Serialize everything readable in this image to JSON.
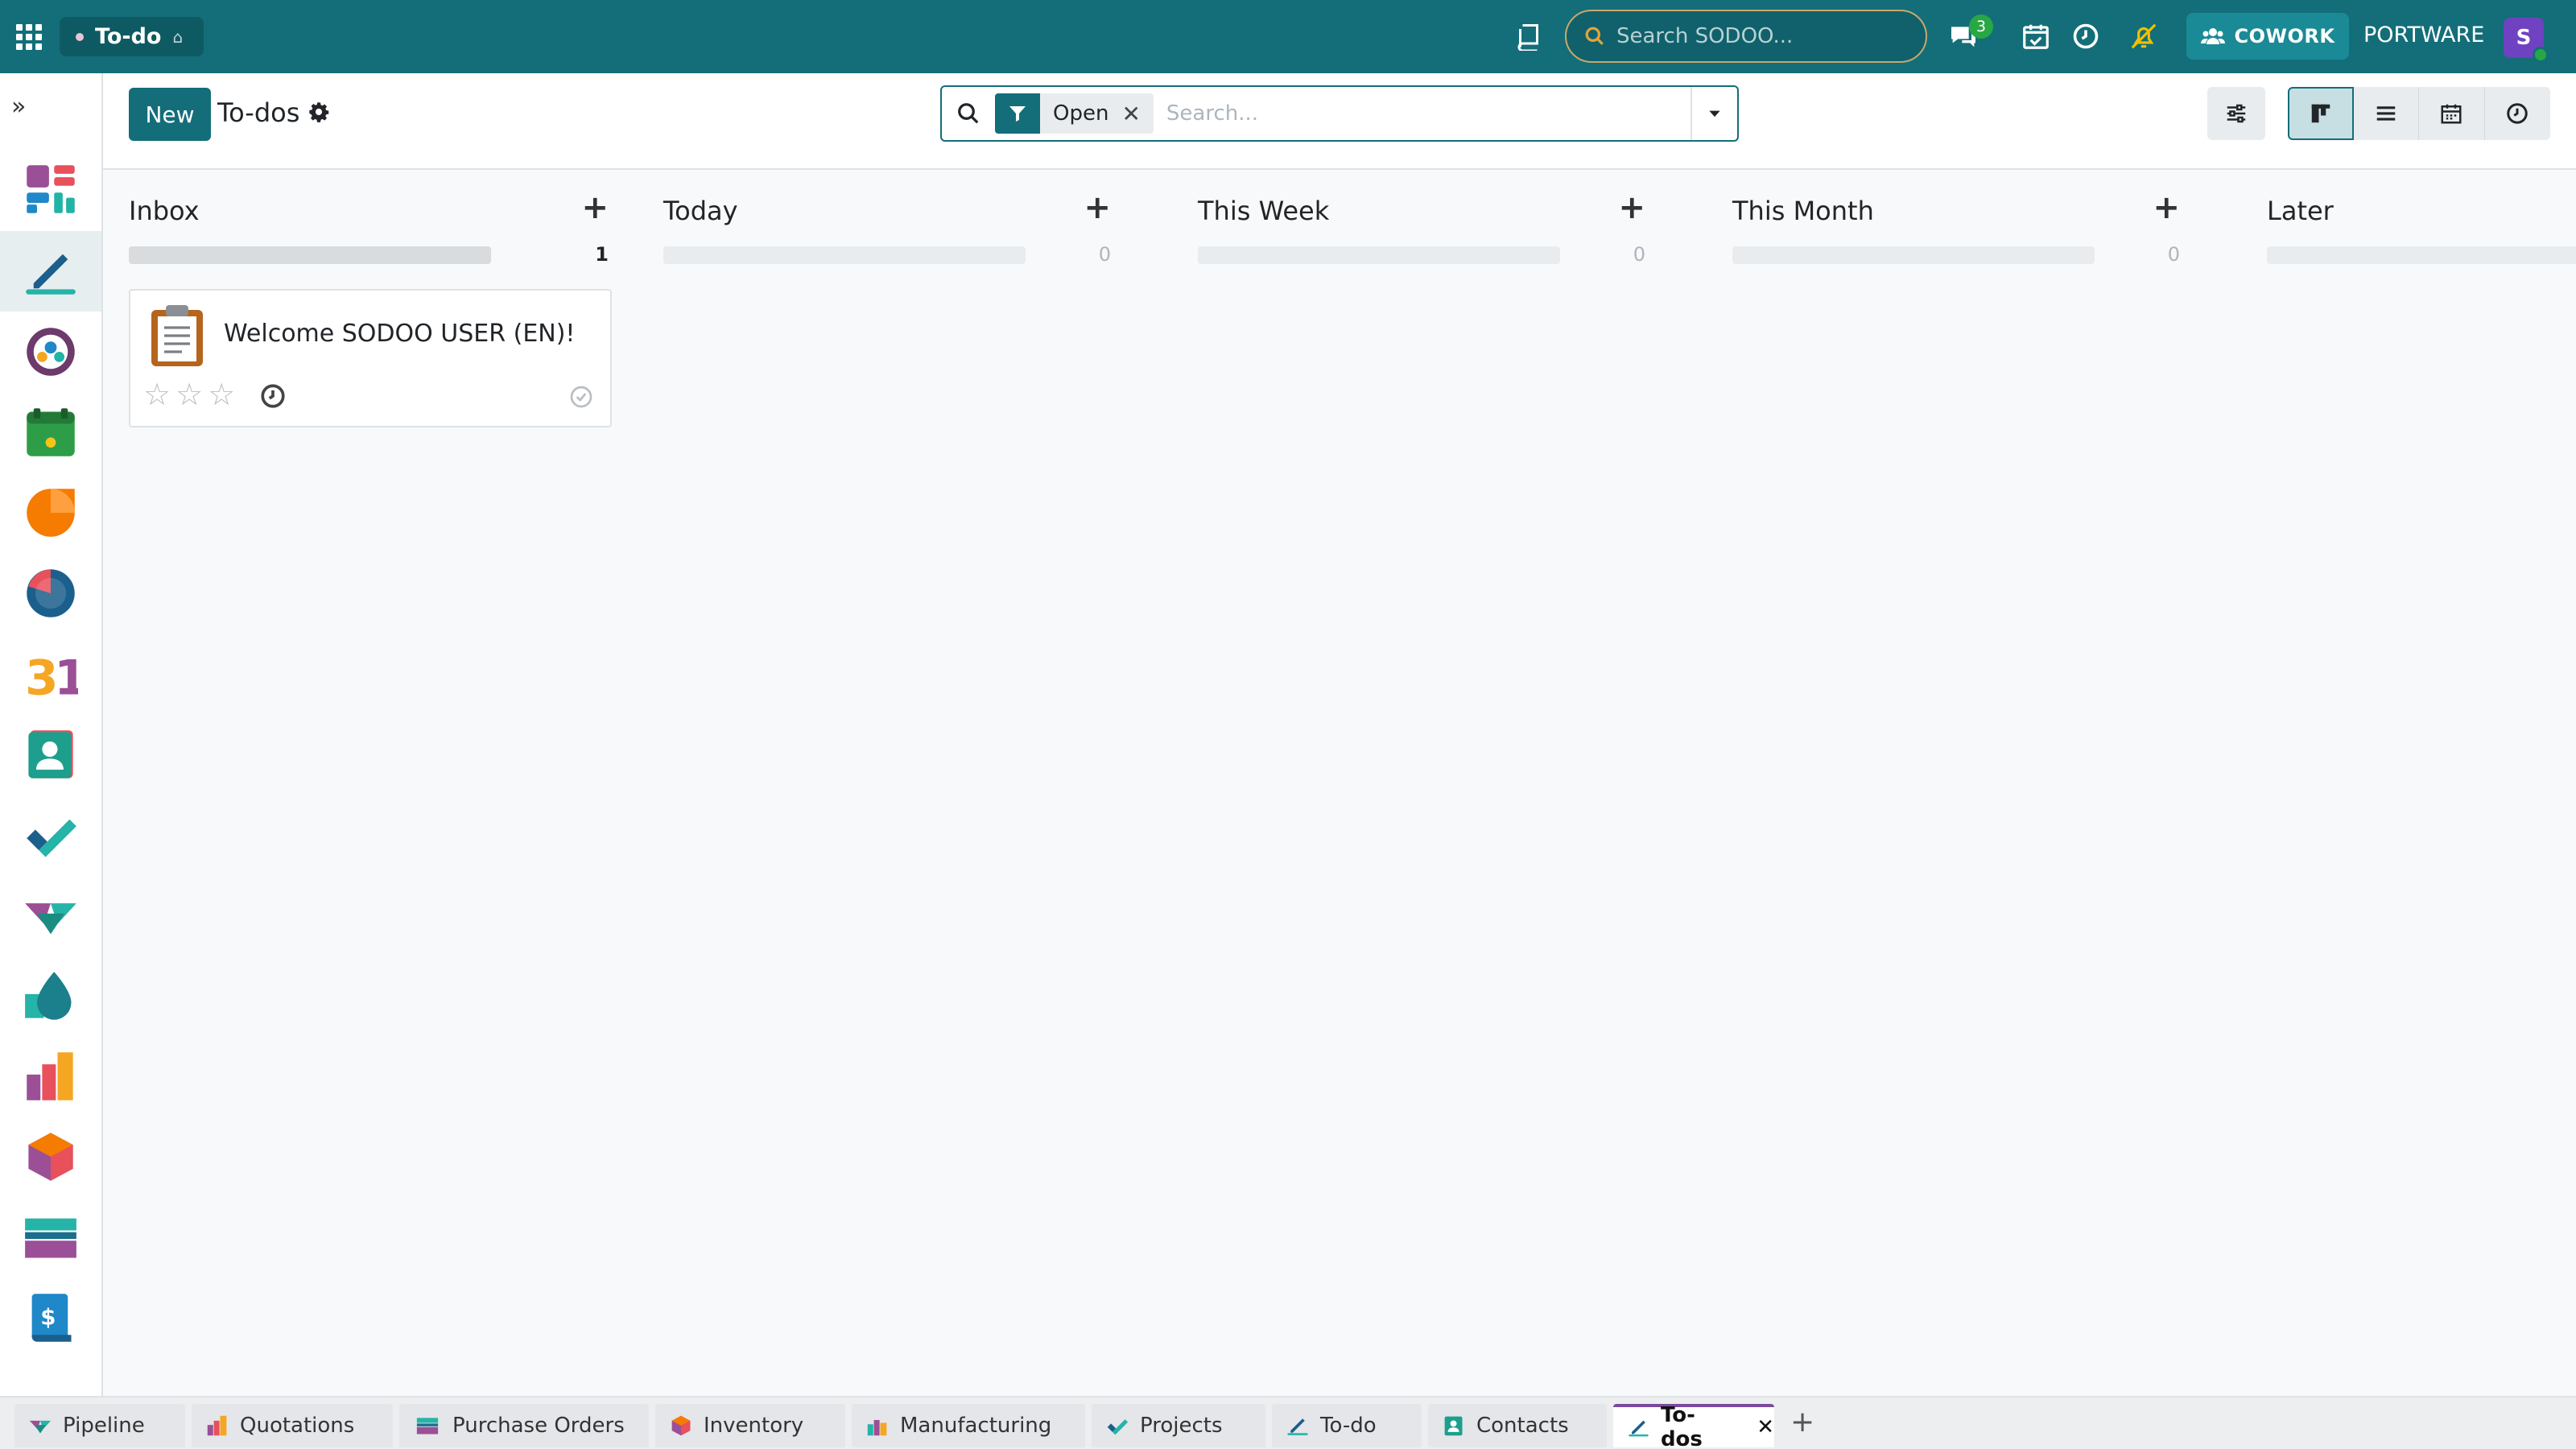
{
  "topbar": {
    "app_name": "To-do",
    "search_placeholder": "Search SODOO...",
    "chat_badge": "3",
    "cowork_label": "COWORK",
    "company": "PORTWARE",
    "avatar_letter": "S"
  },
  "control": {
    "new_label": "New",
    "title": "To-dos",
    "facet_label": "Open",
    "search_placeholder": "Search..."
  },
  "columns": [
    {
      "title": "Inbox",
      "count": "1"
    },
    {
      "title": "Today",
      "count": "0"
    },
    {
      "title": "This Week",
      "count": "0"
    },
    {
      "title": "This Month",
      "count": "0"
    },
    {
      "title": "Later",
      "count": ""
    }
  ],
  "card": {
    "title": "Welcome SODOO USER (EN)!",
    "priority_stars": 0,
    "max_stars": 3
  },
  "tabs": [
    {
      "label": "Pipeline",
      "icon": "pipeline-icon"
    },
    {
      "label": "Quotations",
      "icon": "quotations-icon"
    },
    {
      "label": "Purchase Orders",
      "icon": "purchase-icon"
    },
    {
      "label": "Inventory",
      "icon": "inventory-icon"
    },
    {
      "label": "Manufacturing",
      "icon": "manufacturing-icon"
    },
    {
      "label": "Projects",
      "icon": "projects-icon"
    },
    {
      "label": "To-do",
      "icon": "todo-icon"
    },
    {
      "label": "Contacts",
      "icon": "contacts-icon"
    },
    {
      "label": "To-dos",
      "icon": "todo-icon"
    }
  ],
  "colors": {
    "brand": "#136e79",
    "active_tab_accent": "#7b4a9f"
  }
}
